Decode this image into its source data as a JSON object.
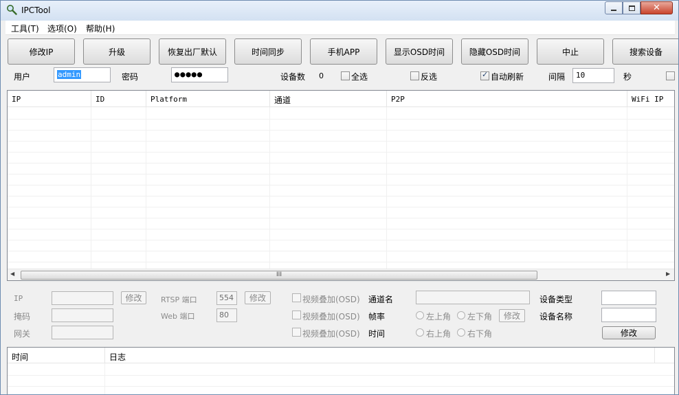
{
  "window": {
    "title": "IPCTool"
  },
  "menu": [
    "工具(T)",
    "选项(O)",
    "帮助(H)"
  ],
  "toolbar": {
    "buttons": [
      "修改IP",
      "升级",
      "恢复出厂默认",
      "时间同步",
      "手机APP",
      "显示OSD时间",
      "隐藏OSD时间",
      "中止",
      "搜索设备"
    ]
  },
  "login": {
    "user_label": "用户",
    "user_value": "admin",
    "password_label": "密码",
    "password_value": "●●●●●",
    "device_count_label": "设备数",
    "device_count": "0",
    "select_all": "全选",
    "invert_select": "反选",
    "auto_refresh": "自动刷新",
    "auto_refresh_checked": true,
    "interval_label": "间隔",
    "interval_value": "10",
    "seconds_label": "秒"
  },
  "device_table": {
    "columns": [
      "IP",
      "ID",
      "Platform",
      "通道",
      "P2P",
      "WiFi IP"
    ],
    "rows": [],
    "scroll_grip": "III"
  },
  "settings": {
    "ip_label": "IP",
    "mask_label": "掩码",
    "gateway_label": "网关",
    "modify_ip_button": "修改",
    "rtsp_port_label": "RTSP 端口",
    "rtsp_port_value": "554",
    "rtsp_modify_button": "修改",
    "web_port_label": "Web 端口",
    "web_port_value": "80",
    "osd_checks": [
      "视频叠加(OSD)",
      "视频叠加(OSD)",
      "视频叠加(OSD)"
    ],
    "channel_name_label": "通道名",
    "frame_rate_label": "帧率",
    "time_label": "时间",
    "positions": [
      "左上角",
      "左下角",
      "右上角",
      "右下角"
    ],
    "osd_modify_button": "修改",
    "device_type_label": "设备类型",
    "device_name_label": "设备名称",
    "device_modify_button": "修改"
  },
  "log": {
    "columns": [
      "时间",
      "日志"
    ]
  }
}
